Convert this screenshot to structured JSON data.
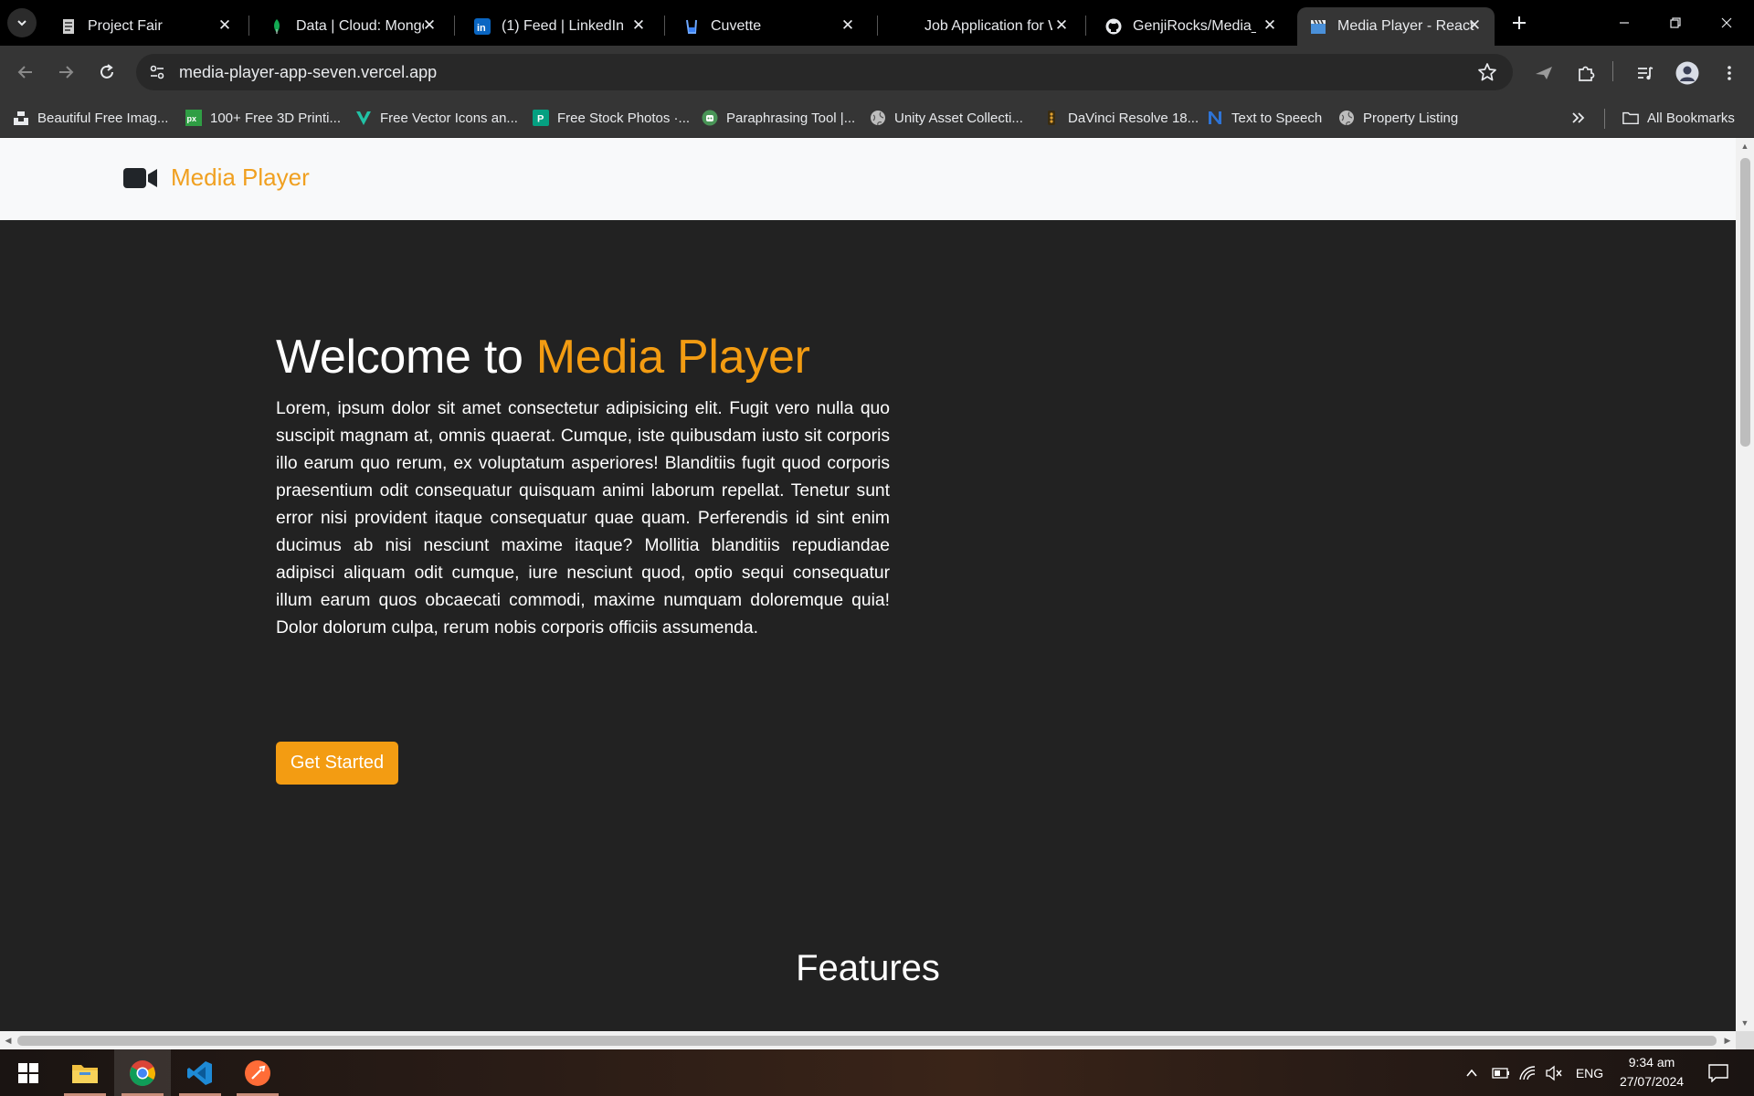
{
  "browser": {
    "tabs": [
      {
        "title": "Project Fair",
        "active": false
      },
      {
        "title": "Data | Cloud: MongoDB",
        "active": false
      },
      {
        "title": "(1) Feed | LinkedIn",
        "active": false
      },
      {
        "title": "Cuvette",
        "active": false
      },
      {
        "title": "Job Application for W",
        "active": false
      },
      {
        "title": "GenjiRocks/Media_Pl",
        "active": false
      },
      {
        "title": "Media Player - React",
        "active": true
      }
    ],
    "url": "media-player-app-seven.vercel.app",
    "bookmarks": [
      {
        "label": "Beautiful Free Imag..."
      },
      {
        "label": "100+ Free 3D Printi..."
      },
      {
        "label": "Free Vector Icons an..."
      },
      {
        "label": "Free Stock Photos ·..."
      },
      {
        "label": "Paraphrasing Tool |..."
      },
      {
        "label": "Unity Asset Collecti..."
      },
      {
        "label": "DaVinci Resolve 18..."
      },
      {
        "label": "Text to Speech"
      },
      {
        "label": "Property Listing"
      }
    ],
    "all_bookmarks_label": "All Bookmarks"
  },
  "page": {
    "brand": "Media Player",
    "hero": {
      "title_prefix": "Welcome to ",
      "title_accent": "Media Player",
      "body": "Lorem, ipsum dolor sit amet consectetur adipisicing elit. Fugit vero nulla quo suscipit magnam at, omnis quaerat. Cumque, iste quibusdam iusto sit corporis illo earum quo rerum, ex voluptatum asperiores! Blanditiis fugit quod corporis praesentium odit consequatur quisquam animi laborum repellat. Tenetur sunt error nisi provident itaque consequatur quae quam. Perferendis id sint enim ducimus ab nisi nesciunt maxime itaque? Mollitia blanditiis repudiandae adipisci aliquam odit cumque, iure nesciunt quod, optio sequi consequatur illum earum quos obcaecati commodi, maxime numquam doloremque quia! Dolor dolorum culpa, rerum nobis corporis officiis assumenda.",
      "cta": "Get Started"
    },
    "features_heading": "Features"
  },
  "taskbar": {
    "language": "ENG",
    "time": "9:34 am",
    "date": "27/07/2024"
  },
  "colors": {
    "accent": "#f39c12",
    "page_bg": "#222222",
    "navbar_bg": "#f8f9fa"
  }
}
